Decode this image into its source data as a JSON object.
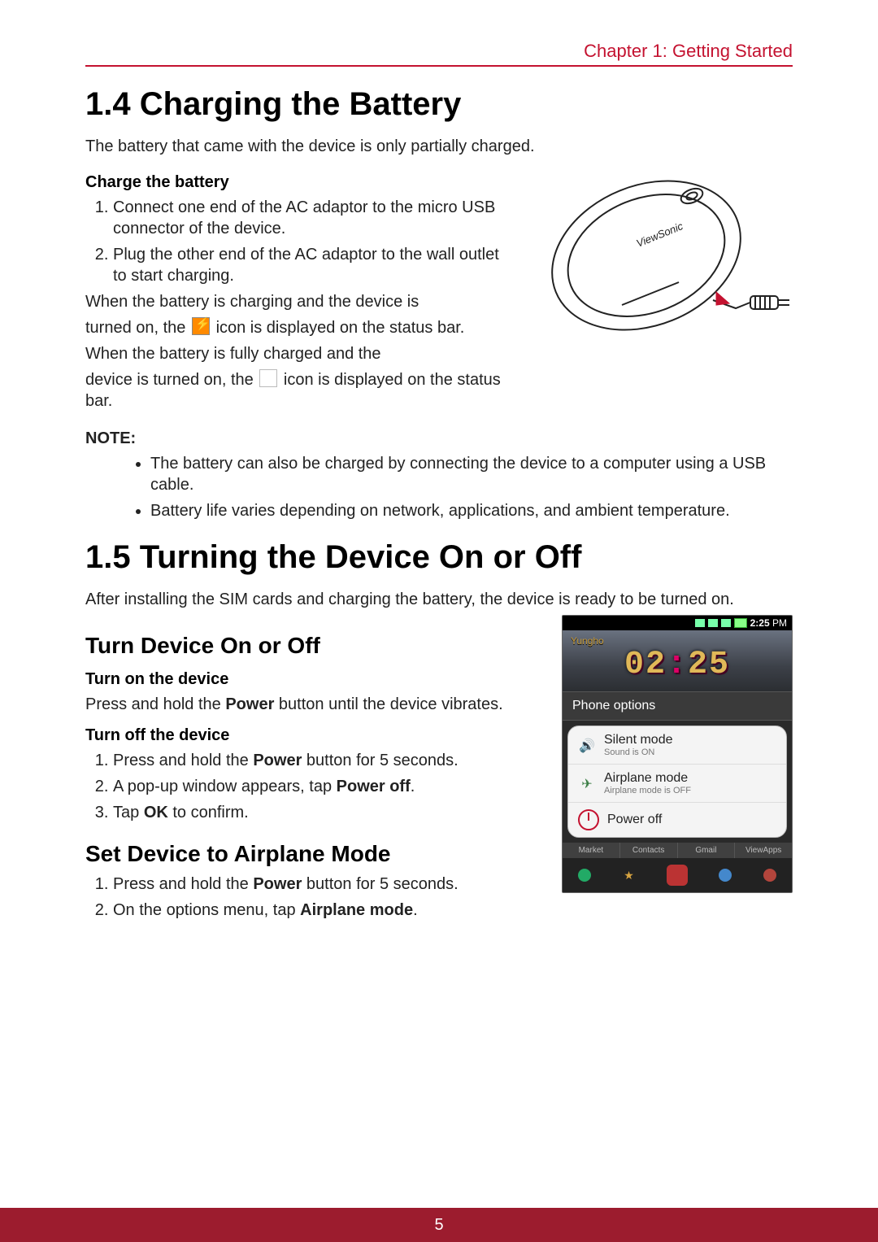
{
  "chapter": "Chapter 1: Getting Started",
  "page_number": "5",
  "sections": {
    "s14": {
      "heading": "1.4 Charging the Battery",
      "intro": "The battery that came with the device is only partially charged.",
      "sub1_title": "Charge the battery",
      "step1": "Connect one end of the AC adaptor to the micro USB connector of the device.",
      "step2": "Plug the other end of the AC adaptor to the wall outlet to start charging.",
      "charging_a": "When the battery is charging and the device is",
      "charging_b": "turned on, the",
      "charging_c": "icon is displayed on the status bar.",
      "full_a": "When the battery is fully charged and the",
      "full_b": "device is turned on, the",
      "full_c": "icon is displayed on the status bar.",
      "note_label": "NOTE:",
      "note1": "The battery can also be charged by connecting the device to a computer using a USB cable.",
      "note2": "Battery life varies depending on network, applications, and ambient temperature."
    },
    "s15": {
      "heading": "1.5 Turning the Device On or Off",
      "intro": "After installing the SIM cards and charging the battery, the device is ready to be turned on.",
      "sub1": "Turn Device On or Off",
      "turnon_title": "Turn on the device",
      "turnon_a": "Press and hold the ",
      "turnon_b": "Power",
      "turnon_c": " button until the device vibrates.",
      "turnoff_title": "Turn off the device",
      "turnoff1_a": "Press and hold the ",
      "turnoff1_b": "Power",
      "turnoff1_c": " button for 5 seconds.",
      "turnoff2_a": "A pop-up window appears, tap ",
      "turnoff2_b": "Power off",
      "turnoff2_c": ".",
      "turnoff3_a": "Tap ",
      "turnoff3_b": "OK",
      "turnoff3_c": " to confirm.",
      "sub2": "Set Device to Airplane Mode",
      "airplane1_a": "Press and hold the ",
      "airplane1_b": "Power",
      "airplane1_c": " button for 5 seconds.",
      "airplane2_a": "On the options menu, tap ",
      "airplane2_b": "Airplane mode",
      "airplane2_c": "."
    }
  },
  "device_illustration": {
    "brand": "ViewSonic"
  },
  "phone": {
    "time": "2:25",
    "ampm": "PM",
    "yungho": "Yungho",
    "clock_display": "02:25",
    "options_label": "Phone options",
    "silent_title": "Silent mode",
    "silent_sub": "Sound is ON",
    "airplane_title": "Airplane mode",
    "airplane_sub": "Airplane mode is OFF",
    "poweroff": "Power off",
    "tabs": {
      "market": "Market",
      "contacts": "Contacts",
      "gmail": "Gmail",
      "viewapps": "ViewApps"
    }
  }
}
